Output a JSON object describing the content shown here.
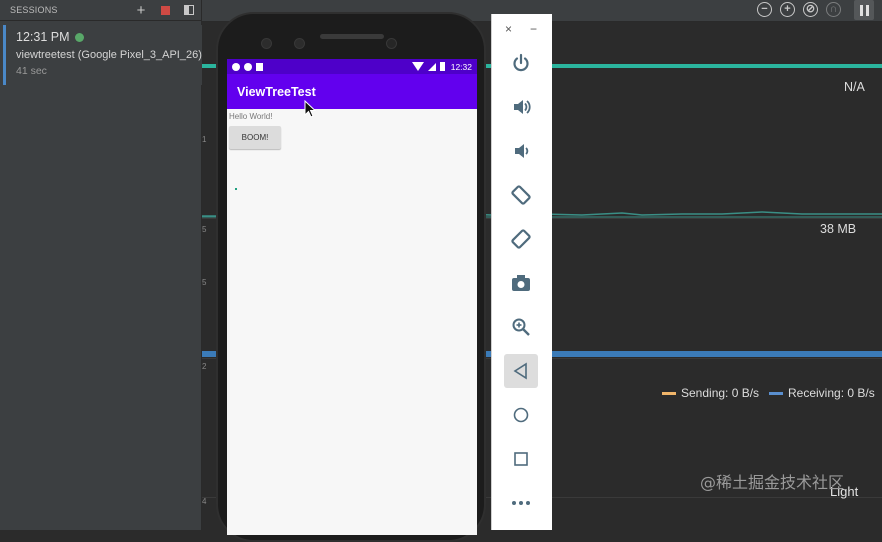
{
  "sessions": {
    "title": "SESSIONS",
    "add_icon": "plus-icon",
    "stop_icon": "stop-icon",
    "toggle_icon": "panel-toggle-icon",
    "session": {
      "time": "12:31 PM",
      "status_color": "#59a869",
      "name": "viewtreetest (Google Pixel_3_API_26)",
      "duration": "41 sec"
    }
  },
  "profiler": {
    "toolbar_icons": [
      "zoom-out-icon",
      "zoom-in-icon",
      "reset-zoom-icon",
      "attach-icon",
      "pause-icon"
    ],
    "cpu_value": "N/A",
    "memory_value": "38 MB",
    "network_legend": {
      "sending": "Sending: 0 B/s",
      "receiving": "Receiving: 0 B/s",
      "sending_color": "#f0b56a",
      "receiving_color": "#5a8fcf"
    },
    "energy_value": "Light",
    "track_colors": {
      "cpu": "#2bb59e",
      "memory": "#3a8f86",
      "network": "#3b7bb8"
    },
    "axis_ticks": [
      "1",
      "5",
      "5",
      "2",
      "4"
    ]
  },
  "device": {
    "status_time": "12:32",
    "app_title": "ViewTreeTest",
    "hello_text": "Hello World!",
    "boom_label": "BOOM!",
    "status_bar_color": "#4e00c9",
    "app_bar_color": "#6200ee"
  },
  "emulator_toolbar": {
    "close": "×",
    "minimize": "−",
    "buttons": [
      "power-icon",
      "volume-up-icon",
      "volume-down-icon",
      "rotate-left-icon",
      "rotate-right-icon",
      "camera-icon",
      "zoom-icon",
      "back-icon",
      "home-icon",
      "overview-icon",
      "more-icon"
    ],
    "active_button": "back-icon"
  },
  "watermark": "@稀土掘金技术社区"
}
